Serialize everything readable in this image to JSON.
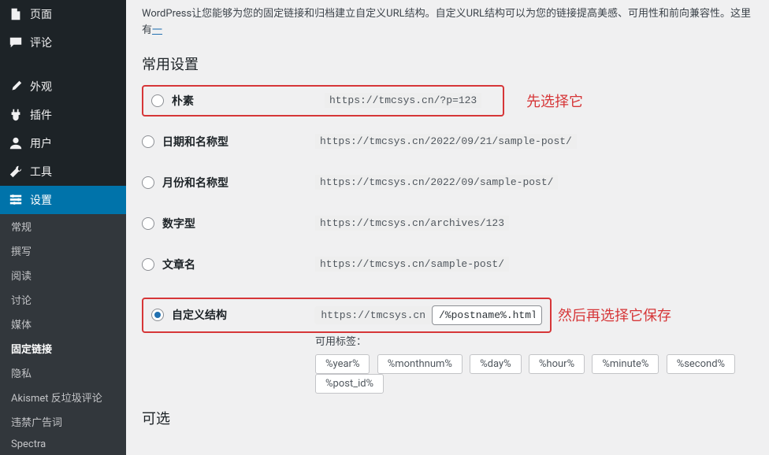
{
  "intro": {
    "text_prefix": "WordPress让您能够为您的固定链接和归档建立自定义URL结构。自定义URL结构可以为您的链接提高美感、可用性和前向兼容性。这里有",
    "link": "一"
  },
  "section_title": "常用设置",
  "optional_title": "可选",
  "sidebar": {
    "items": [
      {
        "label": "页面"
      },
      {
        "label": "评论"
      },
      {
        "label": "外观"
      },
      {
        "label": "插件"
      },
      {
        "label": "用户"
      },
      {
        "label": "工具"
      },
      {
        "label": "设置"
      }
    ],
    "sub": [
      {
        "label": "常规"
      },
      {
        "label": "撰写"
      },
      {
        "label": "阅读"
      },
      {
        "label": "讨论"
      },
      {
        "label": "媒体"
      },
      {
        "label": "固定链接"
      },
      {
        "label": "隐私"
      },
      {
        "label": "Akismet 反垃圾评论"
      },
      {
        "label": "违禁广告词"
      },
      {
        "label": "Spectra"
      }
    ]
  },
  "options": {
    "plain": {
      "label": "朴素",
      "url": "https://tmcsys.cn/?p=123"
    },
    "daynamename": {
      "label": "日期和名称型",
      "url": "https://tmcsys.cn/2022/09/21/sample-post/"
    },
    "monthname": {
      "label": "月份和名称型",
      "url": "https://tmcsys.cn/2022/09/sample-post/"
    },
    "numeric": {
      "label": "数字型",
      "url": "https://tmcsys.cn/archives/123"
    },
    "postname": {
      "label": "文章名",
      "url": "https://tmcsys.cn/sample-post/"
    },
    "custom": {
      "label": "自定义结构",
      "prefix": "https://tmcsys.cn",
      "value": "/%postname%.html"
    }
  },
  "annotations": {
    "first": "先选择它",
    "second": "然后再选择它保存"
  },
  "tags": {
    "label": "可用标签：",
    "items": [
      "%year%",
      "%monthnum%",
      "%day%",
      "%hour%",
      "%minute%",
      "%second%",
      "%post_id%"
    ]
  }
}
